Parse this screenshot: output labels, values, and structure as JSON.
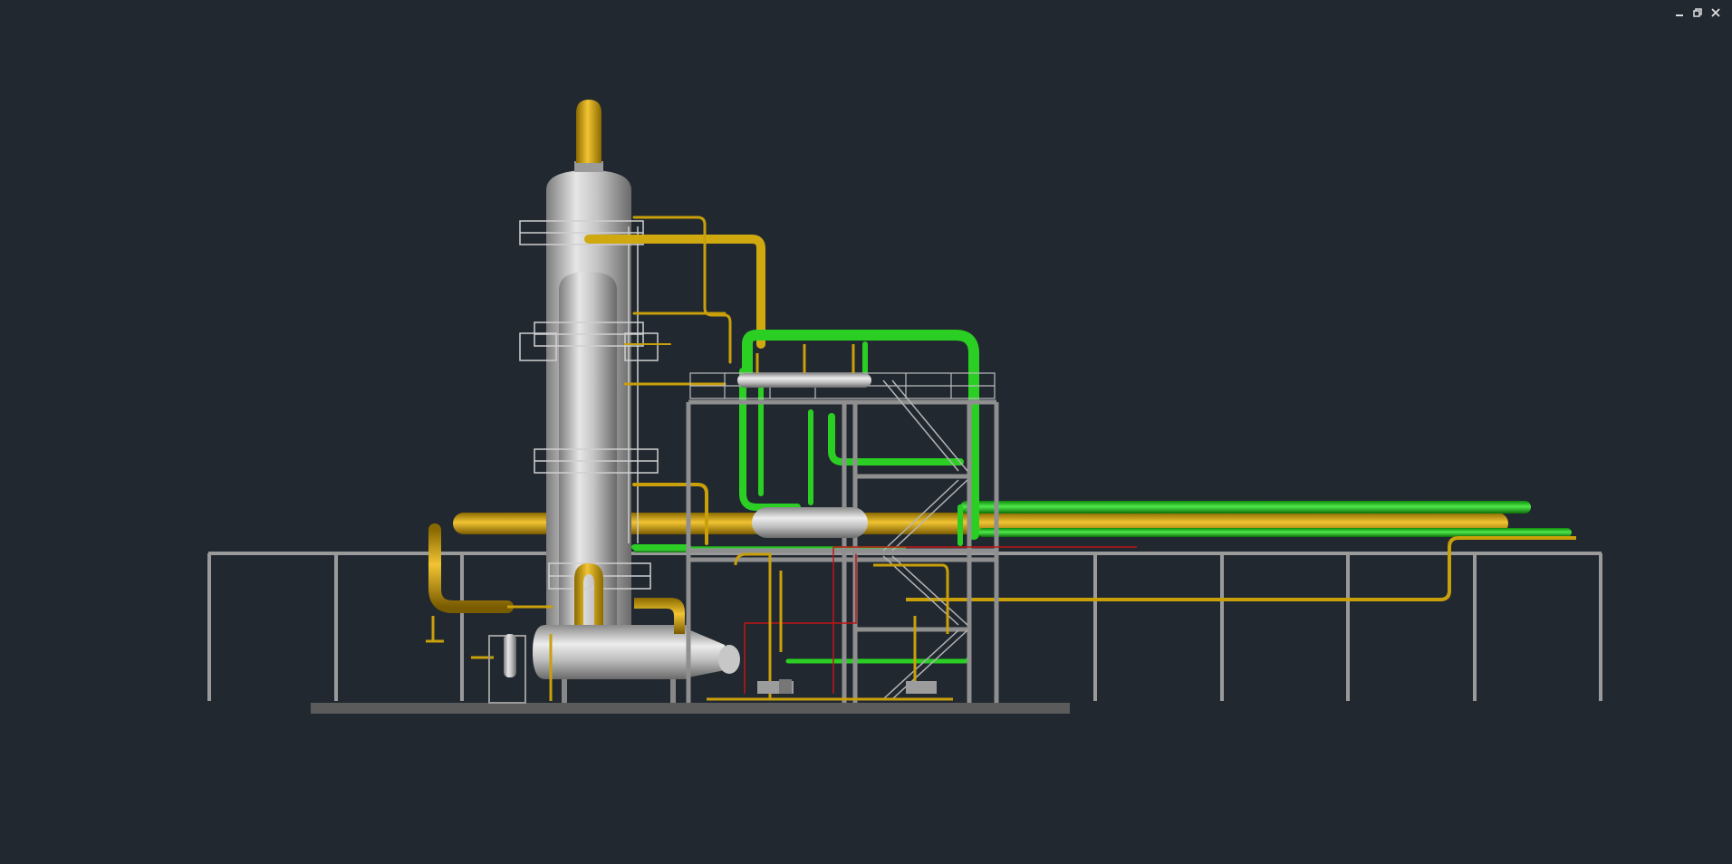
{
  "viewport": {
    "background": "#212830",
    "view_style": "shaded 3D plant model"
  },
  "window_controls": {
    "minimize_icon": "minimize-icon",
    "restore_icon": "restore-icon",
    "close_icon": "close-icon"
  },
  "colors": {
    "vessel_steel": "#a8a8a8",
    "pipe_yellow": "#c9a00a",
    "pipe_green": "#22c21c",
    "structure_grey": "#8a8a8a",
    "handrail": "#bdbdbd",
    "red_line": "#c01515"
  }
}
